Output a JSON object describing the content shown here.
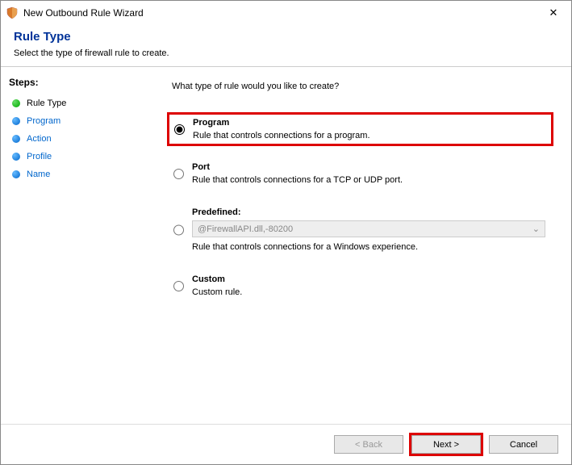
{
  "window": {
    "title": "New Outbound Rule Wizard",
    "close_label": "✕"
  },
  "header": {
    "title": "Rule Type",
    "subtitle": "Select the type of firewall rule to create."
  },
  "sidebar": {
    "title": "Steps:",
    "items": [
      {
        "label": "Rule Type",
        "state": "current"
      },
      {
        "label": "Program",
        "state": "upcoming"
      },
      {
        "label": "Action",
        "state": "upcoming"
      },
      {
        "label": "Profile",
        "state": "upcoming"
      },
      {
        "label": "Name",
        "state": "upcoming"
      }
    ]
  },
  "main": {
    "question": "What type of rule would you like to create?",
    "options": {
      "program": {
        "label": "Program",
        "desc": "Rule that controls connections for a program.",
        "selected": true
      },
      "port": {
        "label": "Port",
        "desc": "Rule that controls connections for a TCP or UDP port.",
        "selected": false
      },
      "predefined": {
        "label": "Predefined:",
        "select_value": "@FirewallAPI.dll,-80200",
        "desc": "Rule that controls connections for a Windows experience.",
        "selected": false
      },
      "custom": {
        "label": "Custom",
        "desc": "Custom rule.",
        "selected": false
      }
    }
  },
  "footer": {
    "back": "< Back",
    "next": "Next >",
    "cancel": "Cancel"
  }
}
